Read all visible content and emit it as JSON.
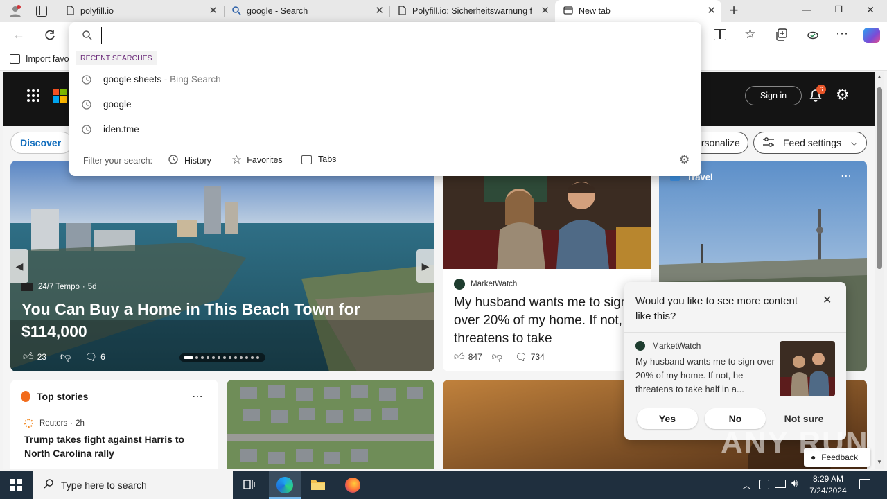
{
  "tabs": [
    {
      "title": "polyfill.io",
      "active": false
    },
    {
      "title": "google - Search",
      "active": false
    },
    {
      "title": "Polyfill.io: Sicherheitswarnung fü",
      "active": false
    },
    {
      "title": "New tab",
      "active": true
    }
  ],
  "new_tab_symbol": "+",
  "window_controls": {
    "minimize": "—",
    "restore": "❐",
    "close": "✕"
  },
  "address_bar": {
    "value": "",
    "placeholder": ""
  },
  "bookmarks": {
    "import_label": "Import favo"
  },
  "omnibox": {
    "recent_header": "RECENT SEARCHES",
    "suggestions": [
      {
        "text": "google sheets",
        "suffix": "- Bing Search"
      },
      {
        "text": "google",
        "suffix": ""
      },
      {
        "text": "iden.tme",
        "suffix": ""
      }
    ],
    "filter_label": "Filter your search:",
    "filters": [
      "History",
      "Favorites",
      "Tabs"
    ]
  },
  "msn": {
    "sign_in": "Sign in",
    "notification_count": "6",
    "discover": "Discover",
    "personalize": "ersonalize",
    "feed_settings": "Feed settings",
    "hero": {
      "source": "24/7 Tempo",
      "age": "5d",
      "title": "You Can Buy a Home in This Beach Town for $114,000",
      "likes": "23",
      "comments": "6"
    },
    "card2": {
      "source": "MarketWatch",
      "title": "My husband wants me to sign over 20% of my home. If not, he threatens to take",
      "likes": "847",
      "comments": "734"
    },
    "travel_label": "Travel",
    "top_stories": {
      "header": "Top stories",
      "source": "Reuters",
      "age": "2h",
      "headline": "Trump takes fight against Harris to North Carolina rally"
    },
    "feedback": "Feedback"
  },
  "popup": {
    "question": "Would you like to see more content like this?",
    "source": "MarketWatch",
    "snippet": "My husband wants me to sign over 20% of my home. If not, he threatens to take half in a...",
    "yes": "Yes",
    "no": "No",
    "not_sure": "Not sure"
  },
  "watermark": "ANY RUN",
  "taskbar": {
    "search_placeholder": "Type here to search",
    "time": "8:29 AM",
    "date": "7/24/2024"
  },
  "colors": {
    "accent_blue": "#0f6cbd",
    "taskbar_bg": "#1f2f3e",
    "notification_badge": "#e8562a",
    "recent_header_color": "#6b2a7a"
  }
}
